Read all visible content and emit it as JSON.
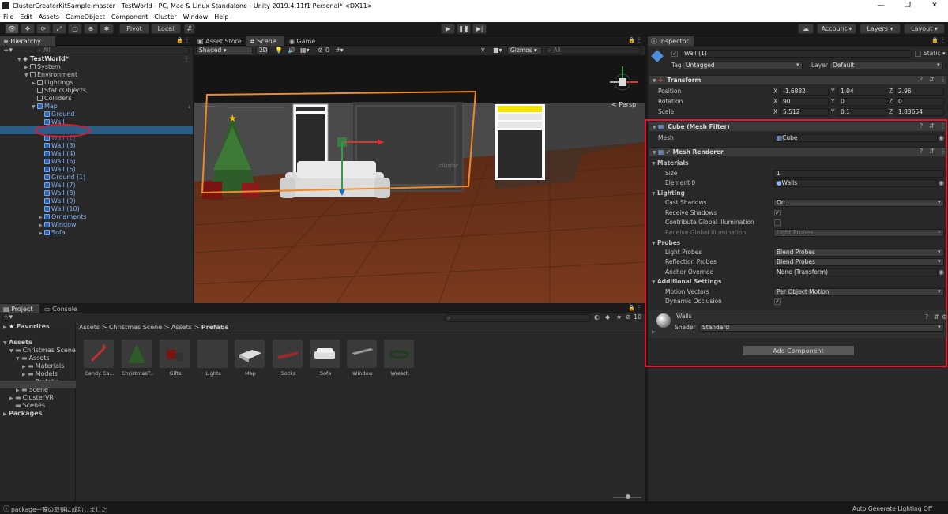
{
  "window": {
    "title": "ClusterCreatorKitSample-master - TestWorld - PC, Mac & Linux Standalone - Unity 2019.4.11f1 Personal* <DX11>",
    "controls": [
      "—",
      "❐",
      "✕"
    ]
  },
  "menu": [
    "File",
    "Edit",
    "Assets",
    "GameObject",
    "Component",
    "Cluster",
    "Window",
    "Help"
  ],
  "toolbar": {
    "pivot": "Pivot",
    "local": "Local",
    "account": "Account",
    "layers": "Layers",
    "layout": "Layout"
  },
  "hierarchy": {
    "tab": "Hierarchy",
    "search_placeholder": "All",
    "scene": "TestWorld*",
    "items": [
      {
        "label": "System",
        "depth": 1
      },
      {
        "label": "Environment",
        "depth": 1
      },
      {
        "label": "Lightings",
        "depth": 2
      },
      {
        "label": "StaticObjects",
        "depth": 2
      },
      {
        "label": "Colliders",
        "depth": 2
      },
      {
        "label": "Map",
        "depth": 2
      },
      {
        "label": "Ground",
        "depth": 3
      },
      {
        "label": "Wall",
        "depth": 3
      },
      {
        "label": "Wall (1)",
        "depth": 3
      },
      {
        "label": "Wall (2)",
        "depth": 3
      },
      {
        "label": "Wall (3)",
        "depth": 3
      },
      {
        "label": "Wall (4)",
        "depth": 3
      },
      {
        "label": "Wall (5)",
        "depth": 3
      },
      {
        "label": "Wall (6)",
        "depth": 3
      },
      {
        "label": "Ground (1)",
        "depth": 3
      },
      {
        "label": "Wall (7)",
        "depth": 3
      },
      {
        "label": "Wall (8)",
        "depth": 3
      },
      {
        "label": "Wall (9)",
        "depth": 3
      },
      {
        "label": "Wall (10)",
        "depth": 3
      },
      {
        "label": "Ornaments",
        "depth": 3
      },
      {
        "label": "Window",
        "depth": 3
      },
      {
        "label": "Sofa",
        "depth": 3
      }
    ],
    "selected": "Wall (1)"
  },
  "scene_tabs": {
    "asset_store": "Asset Store",
    "scene": "Scene",
    "game": "Game"
  },
  "scene_toolbar": {
    "shading": "Shaded",
    "mode2d": "2D",
    "gizmos": "Gizmos",
    "search_placeholder": "All",
    "hidden_count": "0"
  },
  "scene_view": {
    "persp": "< Persp"
  },
  "project": {
    "tab_project": "Project",
    "tab_console": "Console",
    "favorites": "Favorites",
    "tree": [
      {
        "label": "Assets",
        "depth": 0
      },
      {
        "label": "Christmas Scene",
        "depth": 1
      },
      {
        "label": "Assets",
        "depth": 2
      },
      {
        "label": "Materials",
        "depth": 3
      },
      {
        "label": "Models",
        "depth": 3
      },
      {
        "label": "Prefabs",
        "depth": 3
      },
      {
        "label": "Scene",
        "depth": 2
      },
      {
        "label": "ClusterVR",
        "depth": 1
      },
      {
        "label": "Scenes",
        "depth": 1
      },
      {
        "label": "Packages",
        "depth": 0
      }
    ],
    "breadcrumb": [
      "Assets",
      "Christmas Scene",
      "Assets",
      "Prefabs"
    ],
    "assets": [
      "Candy Ca...",
      "ChristmasT...",
      "Gifts",
      "Lights",
      "Map",
      "Socks",
      "Sofa",
      "Window",
      "Wreath"
    ],
    "hidden_count": "10"
  },
  "inspector": {
    "tab": "Inspector",
    "object_name": "Wall (1)",
    "static_label": "Static",
    "tag_label": "Tag",
    "tag_value": "Untagged",
    "layer_label": "Layer",
    "layer_value": "Default",
    "transform": {
      "title": "Transform",
      "position_label": "Position",
      "rotation_label": "Rotation",
      "scale_label": "Scale",
      "position": [
        "-1.6882",
        "1.04",
        "2.96"
      ],
      "rotation": [
        "90",
        "0",
        "0"
      ],
      "scale": [
        "5.512",
        "0.1",
        "1.83654"
      ],
      "axes": [
        "X",
        "Y",
        "Z"
      ]
    },
    "mesh_filter": {
      "title": "Cube (Mesh Filter)",
      "mesh_label": "Mesh",
      "mesh_value": "Cube"
    },
    "mesh_renderer": {
      "title": "Mesh Renderer",
      "materials": "Materials",
      "size_label": "Size",
      "size_value": "1",
      "element0_label": "Element 0",
      "element0_value": "Walls",
      "lighting": "Lighting",
      "cast_shadows_label": "Cast Shadows",
      "cast_shadows_value": "On",
      "receive_shadows_label": "Receive Shadows",
      "contribute_gi_label": "Contribute Global Illumination",
      "receive_gi_label": "Receive Global Illumination",
      "receive_gi_value": "Light Probes",
      "probes": "Probes",
      "light_probes_label": "Light Probes",
      "light_probes_value": "Blend Probes",
      "reflection_probes_label": "Reflection Probes",
      "reflection_probes_value": "Blend Probes",
      "anchor_override_label": "Anchor Override",
      "anchor_override_value": "None (Transform)",
      "additional_settings": "Additional Settings",
      "motion_vectors_label": "Motion Vectors",
      "motion_vectors_value": "Per Object Motion",
      "dynamic_occlusion_label": "Dynamic Occlusion"
    },
    "material": {
      "name": "Walls",
      "shader_label": "Shader",
      "shader_value": "Standard"
    },
    "add_component": "Add Component"
  },
  "status_bar": {
    "left": "package一覧の取得に成功しました",
    "right": "Auto Generate Lighting Off"
  },
  "colors": {
    "highlight_red": "#e8162c",
    "selection_blue": "#2c5d87",
    "orange_select": "#f08a24"
  }
}
